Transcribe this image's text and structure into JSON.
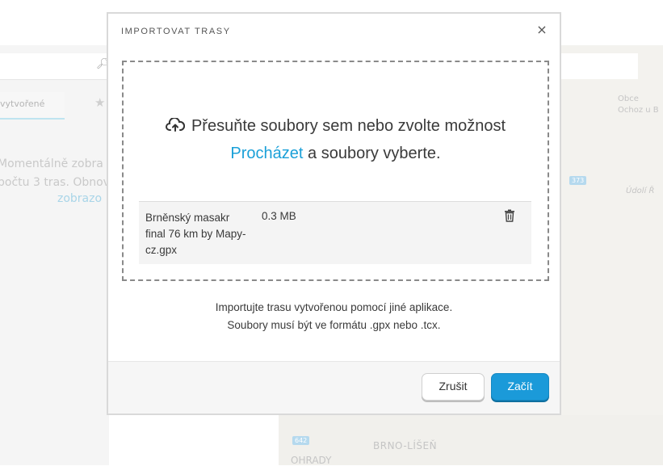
{
  "background": {
    "tab_label": "vytvořené",
    "message_line1": "Momentálně zobra",
    "message_line2": "počtu 3 tras. Obnov",
    "message_link": "zobrazo",
    "map_labels": {
      "obce": "Obce",
      "ochoz": "Ochoz u B",
      "udoli": "Údolí Ř",
      "brno_lisen": "BRNO-LÍŠEŇ",
      "ohrady": "OHRADY"
    },
    "road_badges": [
      "373",
      "642"
    ]
  },
  "dialog": {
    "title": "IMPORTOVAT TRASY",
    "close_symbol": "×",
    "dropzone": {
      "line1": "Přesuňte soubory sem nebo zvolte možnost",
      "browse_link": "Procházet",
      "line2_rest": " a soubory vyberte."
    },
    "files": [
      {
        "name": "Brněnský masakr final 76 km by Mapy-cz.gpx",
        "size": "0.3 MB"
      }
    ],
    "info_line1": "Importujte trasu vytvořenou pomocí jiné aplikace.",
    "info_line2": "Soubory musí být ve formátu .gpx nebo .tcx.",
    "buttons": {
      "cancel": "Zrušit",
      "start": "Začít"
    }
  },
  "colors": {
    "accent": "#1b9ad9",
    "link": "#1aa0d8"
  }
}
